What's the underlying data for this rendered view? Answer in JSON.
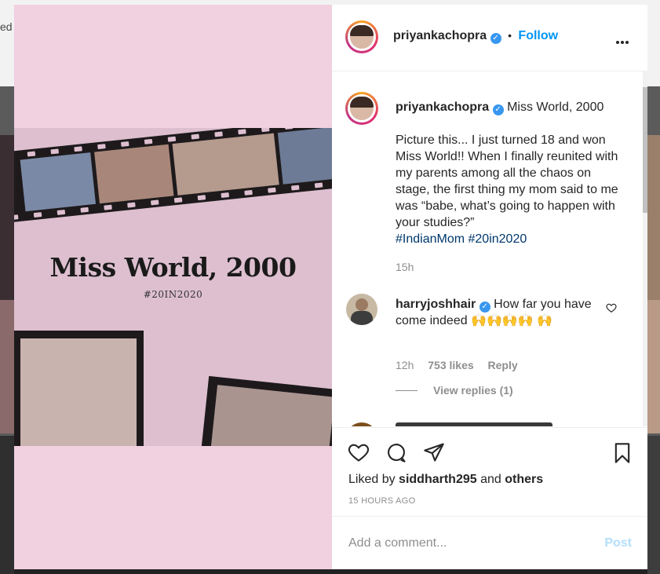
{
  "background": {
    "partial_text": "ed"
  },
  "post": {
    "author": "priyankachopra",
    "follow_label": "Follow",
    "separator": "•",
    "media": {
      "title": "Miss World, 2000",
      "tag": "#20IN2020"
    },
    "caption": {
      "username": "priyankachopra",
      "title": "Miss World, 2000",
      "text": "Picture this... I just turned 18 and won Miss World!! When I finally reunited with my parents among all the chaos on stage, the first thing my mom said to me was “babe, what’s going to happen with your studies?”",
      "hashtags": [
        "#IndianMom",
        "#20in2020"
      ],
      "age": "15h"
    },
    "comments": [
      {
        "username": "harryjoshhair",
        "text": "How far you have come indeed 🙌🙌🙌🙌 🙌",
        "age": "12h",
        "likes": "753 likes",
        "reply_label": "Reply",
        "view_replies": "View replies (1)"
      }
    ],
    "liked_by": {
      "prefix": "Liked by",
      "user": "siddharth295",
      "joiner": "and",
      "others": "others"
    },
    "timestamp": "15 HOURS AGO",
    "add_comment_placeholder": "Add a comment...",
    "post_label": "Post"
  },
  "icons": {
    "verified": "verified-badge-icon",
    "more": "more-options-icon",
    "heart": "heart-icon",
    "comment": "comment-icon",
    "share": "share-icon",
    "save": "bookmark-icon"
  },
  "colors": {
    "accent": "#0095f6",
    "verified": "#3897f0",
    "media_bg": "#f1d0e0",
    "hashtag": "#00376b"
  }
}
